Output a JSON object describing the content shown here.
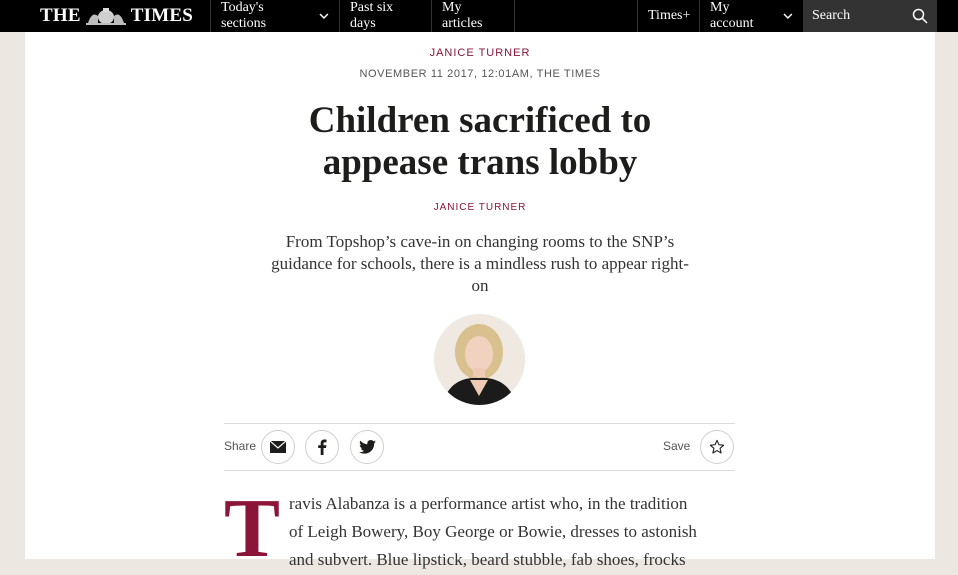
{
  "nav": {
    "logo_left": "THE",
    "logo_right": "TIMES",
    "todays_sections": "Today's sections",
    "past_six_days": "Past six days",
    "my_articles": "My articles",
    "times_plus": "Times+",
    "my_account": "My account",
    "search_placeholder": "Search"
  },
  "article": {
    "kicker": "JANICE TURNER",
    "dateline": "NOVEMBER 11 2017, 12:01AM, THE TIMES",
    "headline_line1": "Children sacrificed to",
    "headline_line2": "appease trans lobby",
    "byline": "JANICE TURNER",
    "standfirst_line1": "From Topshop’s cave-in on changing rooms to the SNP’s",
    "standfirst_line2": "guidance for schools, there is a mindless rush to appear right-",
    "standfirst_line3": "on",
    "dropcap": "T",
    "body_line1": "ravis Alabanza is a performance artist who, in the tradition",
    "body_line2": "of Leigh Bowery, Boy George or Bowie, dresses to astonish",
    "body_line3": "and subvert. Blue lipstick, beard stubble, fab shoes, frocks"
  },
  "toolbar": {
    "share_label": "Share",
    "save_label": "Save"
  },
  "icons": {
    "email": "envelope-icon",
    "facebook": "facebook-icon",
    "twitter": "twitter-icon",
    "save": "star-icon",
    "search": "search-icon"
  },
  "colors": {
    "accent": "#8a1538",
    "topbar": "#000000",
    "search_bg": "#333333",
    "page_bg": "#ece7e1"
  }
}
